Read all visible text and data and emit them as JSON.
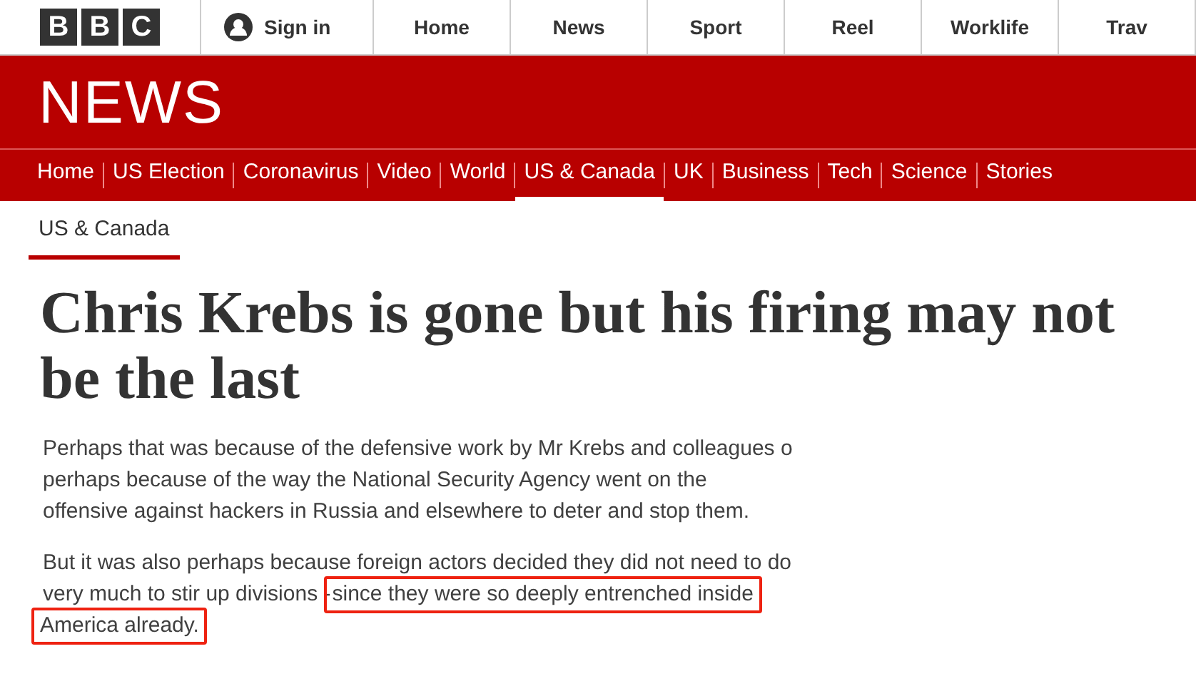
{
  "masthead": {
    "logo_letters": [
      "B",
      "B",
      "C"
    ],
    "sign_in": "Sign in",
    "nav": [
      {
        "label": "Home"
      },
      {
        "label": "News"
      },
      {
        "label": "Sport"
      },
      {
        "label": "Reel"
      },
      {
        "label": "Worklife"
      },
      {
        "label": "Trav"
      }
    ]
  },
  "section_banner": {
    "title": "NEWS"
  },
  "section_nav": [
    {
      "label": "Home",
      "selected": false
    },
    {
      "label": "US Election",
      "selected": false
    },
    {
      "label": "Coronavirus",
      "selected": false
    },
    {
      "label": "Video",
      "selected": false
    },
    {
      "label": "World",
      "selected": false
    },
    {
      "label": "US & Canada",
      "selected": true
    },
    {
      "label": "UK",
      "selected": false
    },
    {
      "label": "Business",
      "selected": false
    },
    {
      "label": "Tech",
      "selected": false
    },
    {
      "label": "Science",
      "selected": false
    },
    {
      "label": "Stories",
      "selected": false
    }
  ],
  "breadcrumb": "US & Canada",
  "headline": "Chris Krebs is gone but his firing may not be the last",
  "paragraphs": [
    {
      "lines": [
        [
          {
            "text": "Perhaps that was because of the defensive work by Mr Krebs and colleagues o",
            "highlighted": false
          }
        ],
        [
          {
            "text": "perhaps because of the way the National Security Agency went on the",
            "highlighted": false
          }
        ],
        [
          {
            "text": "offensive against hackers in Russia and elsewhere to deter and stop them.",
            "highlighted": false
          }
        ]
      ]
    },
    {
      "lines": [
        [
          {
            "text": "But it was also perhaps because foreign actors decided they did not need to do",
            "highlighted": false
          }
        ],
        [
          {
            "text": "very much to stir up divisions -",
            "highlighted": false
          },
          {
            "text": "since they were so deeply entrenched inside",
            "highlighted": true
          }
        ],
        [
          {
            "text": "America already.",
            "highlighted": true
          }
        ]
      ]
    }
  ]
}
